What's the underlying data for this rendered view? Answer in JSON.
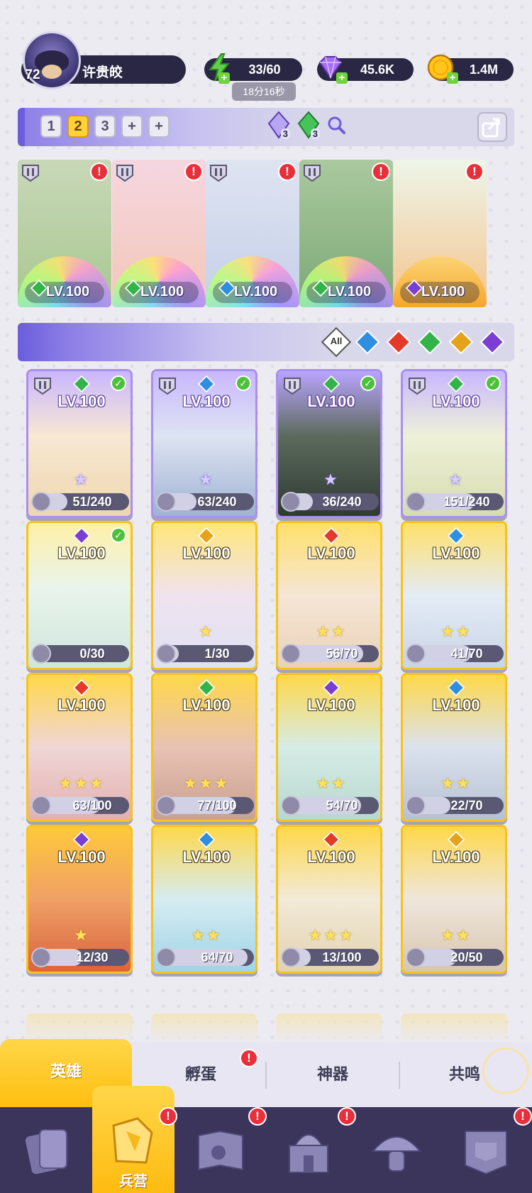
{
  "player": {
    "level": "72",
    "name": "许贵皎"
  },
  "resources": {
    "energy": {
      "value": "33/60",
      "icon": "lightning-icon",
      "timer": "18分16秒"
    },
    "gems": {
      "value": "45.6K",
      "icon": "diamond-icon"
    },
    "gold": {
      "value": "1.4M",
      "icon": "coin-icon"
    }
  },
  "team_bar": {
    "slots": [
      "1",
      "2",
      "3",
      "+",
      "+"
    ],
    "active_slot": "2",
    "crystals": [
      {
        "icon": "purple-crystal-icon",
        "count": "3"
      },
      {
        "icon": "green-crystal-icon",
        "count": "3"
      }
    ],
    "buttons": [
      "search-icon",
      "share-icon"
    ]
  },
  "team_cards": [
    {
      "level": "LV.100",
      "element": "wind",
      "rank": "III",
      "badge": "!"
    },
    {
      "level": "LV.100",
      "element": "wind",
      "rank": "III",
      "badge": "!"
    },
    {
      "level": "LV.100",
      "element": "water",
      "rank": "II",
      "badge": "!"
    },
    {
      "level": "LV.100",
      "element": "wind",
      "rank": "II",
      "badge": "!"
    },
    {
      "level": "LV.100",
      "element": "dark",
      "rank": "",
      "badge": "!"
    }
  ],
  "filters": {
    "all_label": "All",
    "elements": [
      "water",
      "fire",
      "wind",
      "light",
      "dark"
    ]
  },
  "heroes": [
    {
      "level": "LV.100",
      "progress": "51/240",
      "element": "wind",
      "rank": "II",
      "check": true,
      "tier": "purple"
    },
    {
      "level": "LV.100",
      "progress": "63/240",
      "element": "water",
      "rank": "III",
      "check": true,
      "tier": "purple"
    },
    {
      "level": "LV.100",
      "progress": "36/240",
      "element": "wind",
      "rank": "II",
      "check": true,
      "tier": "purple"
    },
    {
      "level": "LV.100",
      "progress": "151/240",
      "element": "wind",
      "rank": "III",
      "check": true,
      "tier": "purple"
    },
    {
      "level": "LV.100",
      "progress": "0/30",
      "element": "dark",
      "check": true,
      "tier": "gold",
      "stars": ""
    },
    {
      "level": "LV.100",
      "progress": "1/30",
      "element": "light",
      "check": false,
      "tier": "gold",
      "stars": "★"
    },
    {
      "level": "LV.100",
      "progress": "56/70",
      "element": "fire",
      "check": false,
      "tier": "gold",
      "stars": "★★"
    },
    {
      "level": "LV.100",
      "progress": "41/70",
      "element": "water",
      "check": false,
      "tier": "gold",
      "stars": "★★"
    },
    {
      "level": "LV.100",
      "progress": "63/100",
      "element": "fire",
      "check": false,
      "tier": "gold",
      "stars": "★★★"
    },
    {
      "level": "LV.100",
      "progress": "77/100",
      "element": "wind",
      "check": false,
      "tier": "gold",
      "stars": "★★★"
    },
    {
      "level": "LV.100",
      "progress": "54/70",
      "element": "dark",
      "check": false,
      "tier": "gold",
      "stars": "★★"
    },
    {
      "level": "LV.100",
      "progress": "22/70",
      "element": "water",
      "check": false,
      "tier": "gold",
      "stars": "★★"
    },
    {
      "level": "LV.100",
      "progress": "12/30",
      "element": "dark",
      "check": false,
      "tier": "gold",
      "stars": "★"
    },
    {
      "level": "LV.100",
      "progress": "64/70",
      "element": "water",
      "check": false,
      "tier": "gold",
      "stars": "★★"
    },
    {
      "level": "LV.100",
      "progress": "13/100",
      "element": "fire",
      "check": false,
      "tier": "gold",
      "stars": "★★★"
    },
    {
      "level": "LV.100",
      "progress": "20/50",
      "element": "light",
      "check": false,
      "tier": "gold",
      "stars": "★★"
    }
  ],
  "subtabs": {
    "heroes": "英雄",
    "hatch": "孵蛋",
    "artifacts": "神器",
    "resonance": "共鸣"
  },
  "nav": {
    "active_label": "兵营",
    "items": [
      "cards-icon",
      "barracks-icon",
      "book-icon",
      "castle-icon",
      "mushroom-icon",
      "banner-icon"
    ],
    "badge": "!"
  },
  "colors": {
    "wind": "#33b449",
    "water": "#2e8fe0",
    "fire": "#e33a2a",
    "light": "#e6a21b",
    "dark": "#7a3fd2",
    "gold_card": "#f6c21c",
    "purple_card": "#a88ff0"
  }
}
